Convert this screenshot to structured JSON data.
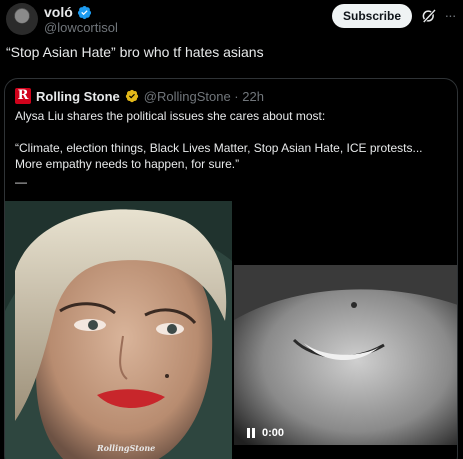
{
  "author": {
    "name": "voló",
    "handle": "@lowcortisol"
  },
  "actions": {
    "subscribe_label": "Subscribe"
  },
  "tweet": {
    "text": "“Stop Asian Hate” bro who tf hates asians"
  },
  "quoted": {
    "name": "Rolling Stone",
    "logo_letter": "R",
    "handle_time": "@RollingStone · 22h",
    "line1": "Alysa Liu shares the political issues she cares about most:",
    "line2": "“Climate, election things, Black Lives Matter, Stop Asian Hate, ICE protests...",
    "line3": "More empathy needs to happen, for sure.”",
    "line4": "—",
    "watermark": "RollingStone",
    "video_time": "0:00"
  },
  "colors": {
    "background": "#000000",
    "text": "#e7e9ea",
    "muted": "#71767b",
    "verified_blue": "#1d9bf0",
    "org_gold": "#e2b719",
    "rs_red": "#d0021b"
  },
  "icons": {
    "verified": "verified-check-icon",
    "grok": "grok-icon",
    "more": "more-options-icon",
    "pause": "pause-icon"
  }
}
